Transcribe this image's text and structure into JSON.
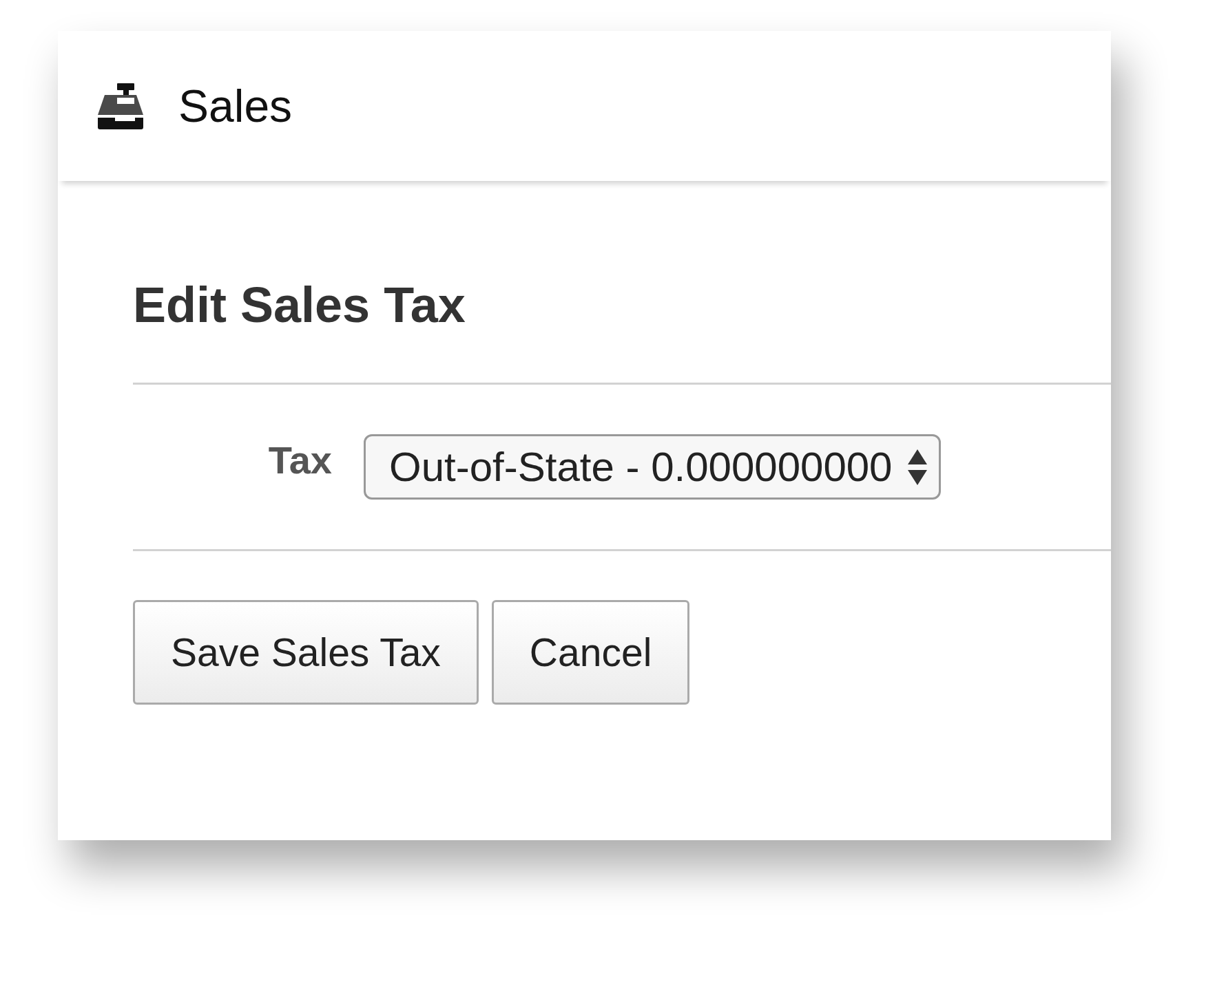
{
  "header": {
    "title": "Sales"
  },
  "form": {
    "title": "Edit Sales Tax",
    "fields": [
      {
        "label": "Tax",
        "kind": "select",
        "value": "Out-of-State - 0.000000000"
      }
    ]
  },
  "buttons": [
    {
      "label": "Save Sales Tax"
    },
    {
      "label": "Cancel"
    }
  ]
}
